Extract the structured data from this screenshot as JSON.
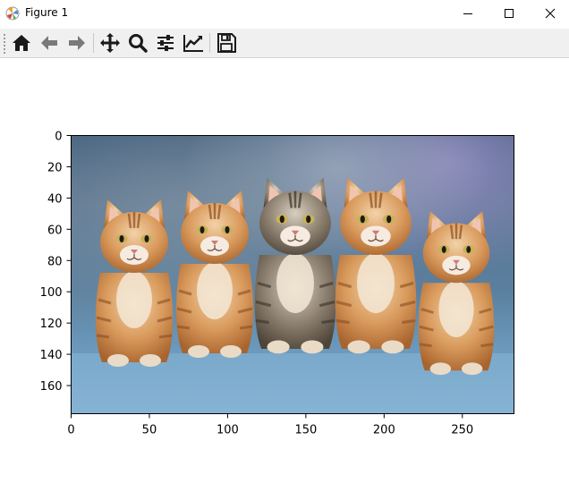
{
  "window": {
    "title": "Figure 1",
    "controls": [
      "minimize",
      "maximize",
      "close"
    ]
  },
  "toolbar": {
    "buttons": [
      {
        "name": "home",
        "icon": "home-icon"
      },
      {
        "name": "back",
        "icon": "arrow-left-icon"
      },
      {
        "name": "forward",
        "icon": "arrow-right-icon"
      },
      {
        "name": "pan",
        "icon": "move-icon"
      },
      {
        "name": "zoom",
        "icon": "magnifier-icon"
      },
      {
        "name": "subplots",
        "icon": "sliders-icon"
      },
      {
        "name": "edit-axis",
        "icon": "line-chart-icon"
      },
      {
        "name": "save",
        "icon": "floppy-disk-icon"
      }
    ]
  },
  "colors": {
    "toolbar_bg": "#f0f0f0",
    "icon": "#1a1a1a",
    "image_bg_top": "#4a6886",
    "image_bg_bottom": "#7aa8c9",
    "kitten_orange": "#d08a4c",
    "kitten_tabby": "#8a7c6a"
  },
  "chart_data": {
    "type": "image",
    "content": "five kittens sitting in a row",
    "x_ticks": [
      "0",
      "50",
      "100",
      "150",
      "200",
      "250"
    ],
    "y_ticks": [
      "0",
      "20",
      "40",
      "60",
      "80",
      "100",
      "120",
      "140",
      "160"
    ],
    "xlim": [
      0,
      283
    ],
    "ylim": [
      178,
      0
    ]
  }
}
